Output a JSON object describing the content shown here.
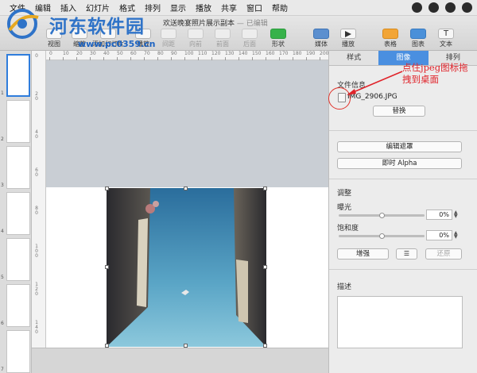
{
  "menubar": {
    "items": [
      "文件",
      "编辑",
      "插入",
      "幻灯片",
      "格式",
      "排列",
      "显示",
      "播放",
      "共享",
      "窗口",
      "帮助"
    ]
  },
  "watermark": {
    "title": "河东软件园",
    "url": "www.pc0359.cn"
  },
  "document": {
    "title": "欢送晚宴照片展示副本",
    "edited": "— 已编辑"
  },
  "toolbar": {
    "left": [
      {
        "label": "视图"
      },
      {
        "label": "缩放"
      },
      {
        "label": "添加幻灯片"
      },
      {
        "label": "播放"
      }
    ],
    "middle": [
      {
        "label": "表格"
      },
      {
        "label": "图表"
      },
      {
        "label": "文本"
      },
      {
        "label": "形状"
      },
      {
        "label": "媒体"
      },
      {
        "label": "批注"
      }
    ],
    "mid_dim": [
      "间距",
      "向前",
      "前面",
      "后面"
    ],
    "shape_label": "形状",
    "media_label": "媒体",
    "play_label": "播放",
    "right": [
      {
        "label": "表格",
        "icon": "table-icon"
      },
      {
        "label": "图表",
        "icon": "chart-icon"
      },
      {
        "label": "文本",
        "icon": "text-icon"
      }
    ]
  },
  "ruler": {
    "horizontal": [
      "0",
      "10",
      "20",
      "30",
      "40",
      "50",
      "60",
      "70",
      "80",
      "90",
      "100",
      "110",
      "120",
      "130",
      "140",
      "150",
      "160",
      "170",
      "180",
      "190",
      "200"
    ],
    "vertical": [
      "0",
      "2\n0",
      "4\n0",
      "6\n0",
      "8\n0",
      "1\n0\n0",
      "1\n2\n0",
      "1\n4\n0"
    ]
  },
  "navigator": {
    "numbers": [
      "1",
      "2",
      "3",
      "4",
      "5",
      "6",
      "7"
    ],
    "selected_index": 0
  },
  "inspector": {
    "tabs": [
      "样式",
      "图像",
      "排列"
    ],
    "active_tab": 1,
    "file_info_label": "文件信息",
    "file_name": "IMG_2906.JPG",
    "replace_button": "替换",
    "edit_mask_button": "编辑遮罩",
    "instant_alpha_button": "即时 Alpha",
    "adjust_label": "调整",
    "exposure_label": "曝光",
    "exposure_value": "0%",
    "exposure_level": 0.5,
    "saturation_label": "饱和度",
    "saturation_value": "0%",
    "saturation_level": 0.5,
    "enhance_button": "增强",
    "reset_button": "还原",
    "description_label": "描述"
  },
  "annotation": {
    "text": "点住jpeg图标拖拽到桌面",
    "color": "#e0232a"
  },
  "colors": {
    "accent": "#4a8fe0",
    "canvas": "#c9ced4",
    "sky_top": "#2a6d9c",
    "sky_bottom": "#8cc8dc"
  }
}
